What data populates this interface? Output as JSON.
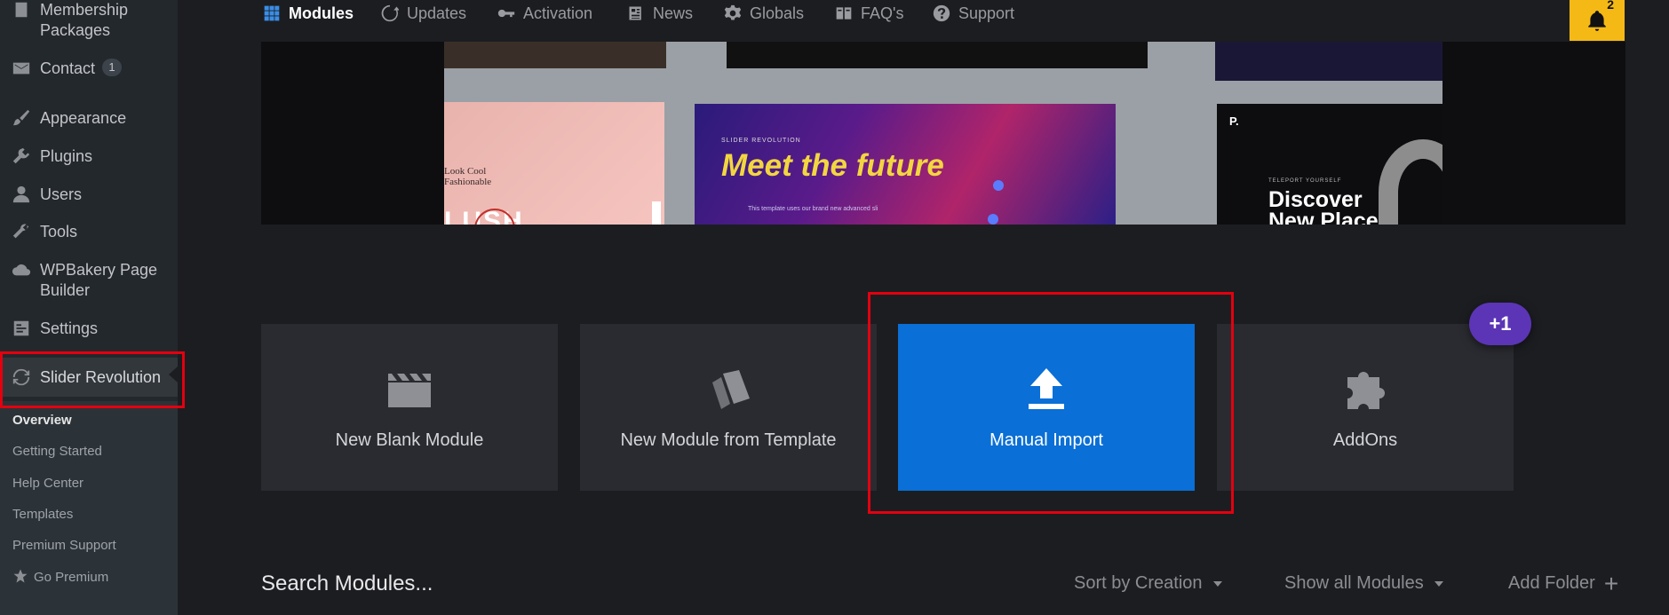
{
  "sidebar": {
    "items": [
      {
        "label": "Membership Packages",
        "icon": "membership-icon"
      },
      {
        "label": "Contact",
        "icon": "mail-icon",
        "badge": "1"
      },
      {
        "label": "Appearance",
        "icon": "brush-icon"
      },
      {
        "label": "Plugins",
        "icon": "plugin-icon"
      },
      {
        "label": "Users",
        "icon": "user-icon"
      },
      {
        "label": "Tools",
        "icon": "wrench-icon"
      },
      {
        "label": "WPBakery Page Builder",
        "icon": "cloud-icon"
      },
      {
        "label": "Settings",
        "icon": "settings-icon"
      },
      {
        "label": "Slider Revolution",
        "icon": "refresh-icon"
      }
    ],
    "submenu": [
      {
        "label": "Overview"
      },
      {
        "label": "Getting Started"
      },
      {
        "label": "Help Center"
      },
      {
        "label": "Templates"
      },
      {
        "label": "Premium Support"
      },
      {
        "label": "Go Premium",
        "icon": "star-icon"
      }
    ]
  },
  "topnav": {
    "items": [
      {
        "label": "Modules",
        "icon": "grid-icon"
      },
      {
        "label": "Updates",
        "icon": "refresh-icon"
      },
      {
        "label": "Activation",
        "icon": "key-icon"
      },
      {
        "label": "News",
        "icon": "newspaper-icon"
      },
      {
        "label": "Globals",
        "icon": "gear-icon"
      },
      {
        "label": "FAQ's",
        "icon": "book-icon"
      },
      {
        "label": "Support",
        "icon": "help-icon"
      }
    ],
    "notifications": {
      "count": "2",
      "icon": "bell-icon"
    }
  },
  "hero": {
    "left_fragment_a": "Look Cool",
    "left_fragment_b": "Fashionable",
    "left_fragment_c": "LUSH",
    "center_heading": "Meet the future",
    "center_small": "SLIDER REVOLUTION",
    "center_body": "This template uses our brand new advanced sli",
    "right_logo": "P.",
    "right_small": "TELEPORT YOURSELF",
    "right_heading_1": "Discover",
    "right_heading_2": "New Places"
  },
  "cards": [
    {
      "label": "New Blank Module",
      "icon": "clapperboard-sparkle-icon"
    },
    {
      "label": "New Module from Template",
      "icon": "template-cards-icon"
    },
    {
      "label": "Manual Import",
      "icon": "upload-icon"
    },
    {
      "label": "AddOns",
      "icon": "puzzle-icon"
    }
  ],
  "addons_badge": "+1",
  "toolbar": {
    "search_title": "Search Modules...",
    "sort_label": "Sort by Creation",
    "filter_label": "Show all Modules",
    "add_folder_label": "Add Folder"
  },
  "colors": {
    "accent_blue": "#0a6fd6",
    "highlight_red": "#e3000f",
    "badge_purple": "#5b35b5",
    "bell_yellow": "#f5b916"
  }
}
